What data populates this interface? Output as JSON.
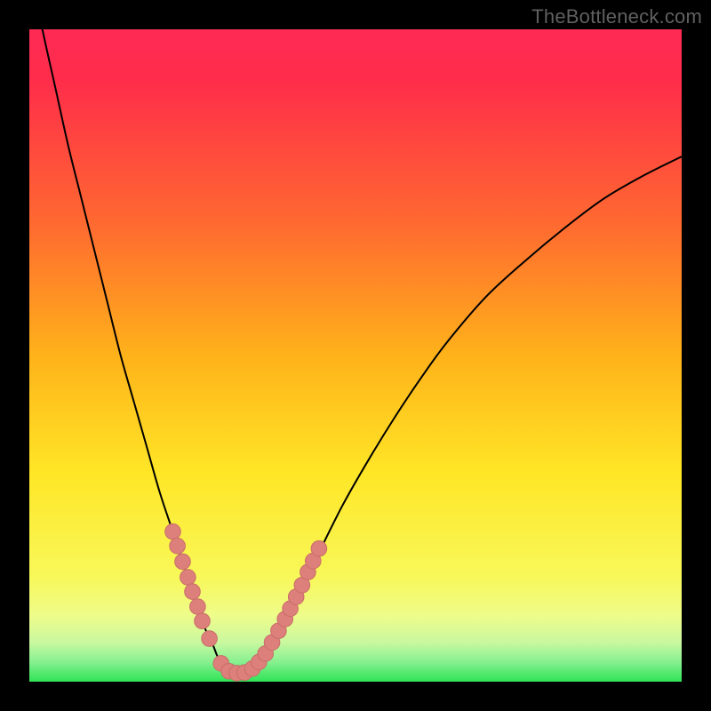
{
  "watermark": "TheBottleneck.com",
  "colors": {
    "bg": "#000000",
    "curve": "#000000",
    "dot_fill": "#dd7f7b",
    "dot_stroke": "#c96e6a",
    "green": "#35e85a",
    "pale_green": "#d0f8b0",
    "yellow": "#fff335",
    "orange": "#ff9a2a",
    "red": "#ff2d4a",
    "magenta": "#ff2a55"
  },
  "chart_data": {
    "type": "line",
    "title": "",
    "xlabel": "",
    "ylabel": "",
    "xlim": [
      0,
      100
    ],
    "ylim": [
      0,
      100
    ],
    "series": [
      {
        "name": "bottleneck-curve",
        "x": [
          0,
          2,
          4,
          6,
          8,
          10,
          12,
          14,
          16,
          18,
          20,
          22,
          24,
          26,
          27,
          28,
          29,
          30,
          31,
          32,
          33,
          34,
          36,
          38,
          40,
          44,
          48,
          52,
          56,
          60,
          64,
          70,
          76,
          82,
          88,
          94,
          100
        ],
        "y": [
          110,
          100,
          91,
          82,
          74,
          66,
          58,
          50,
          43,
          36,
          29,
          23,
          17,
          11,
          8,
          6,
          3.5,
          2,
          1.5,
          1.3,
          1.3,
          1.8,
          3.5,
          7,
          11,
          19,
          27,
          34,
          40.5,
          46.5,
          52,
          59,
          64.5,
          69.5,
          74,
          77.5,
          80.5
        ]
      }
    ],
    "dots": {
      "name": "highlight-dots",
      "points": [
        {
          "x": 22.0,
          "y": 23.0
        },
        {
          "x": 22.7,
          "y": 20.8
        },
        {
          "x": 23.5,
          "y": 18.4
        },
        {
          "x": 24.3,
          "y": 16.0
        },
        {
          "x": 25.0,
          "y": 13.8
        },
        {
          "x": 25.8,
          "y": 11.5
        },
        {
          "x": 26.5,
          "y": 9.3
        },
        {
          "x": 27.6,
          "y": 6.6
        },
        {
          "x": 29.4,
          "y": 2.8
        },
        {
          "x": 30.6,
          "y": 1.6
        },
        {
          "x": 31.8,
          "y": 1.3
        },
        {
          "x": 33.0,
          "y": 1.4
        },
        {
          "x": 34.2,
          "y": 2.0
        },
        {
          "x": 35.2,
          "y": 3.0
        },
        {
          "x": 36.2,
          "y": 4.3
        },
        {
          "x": 37.2,
          "y": 6.0
        },
        {
          "x": 38.2,
          "y": 7.8
        },
        {
          "x": 39.2,
          "y": 9.6
        },
        {
          "x": 40.0,
          "y": 11.2
        },
        {
          "x": 40.9,
          "y": 13.0
        },
        {
          "x": 41.8,
          "y": 14.8
        },
        {
          "x": 42.7,
          "y": 16.8
        },
        {
          "x": 43.5,
          "y": 18.5
        },
        {
          "x": 44.4,
          "y": 20.4
        }
      ]
    }
  }
}
